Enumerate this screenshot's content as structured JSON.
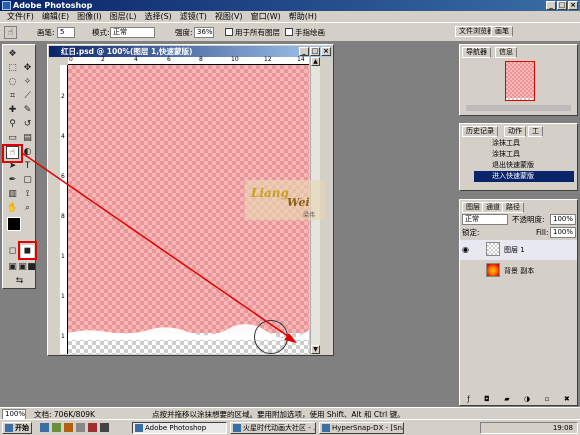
{
  "app": {
    "title": "Adobe Photoshop"
  },
  "menu": [
    "文件(F)",
    "编辑(E)",
    "图像(I)",
    "图层(L)",
    "选择(S)",
    "滤镜(T)",
    "视图(V)",
    "窗口(W)",
    "帮助(H)"
  ],
  "options": {
    "brush_label": "画笔:",
    "brush_size": "5",
    "mode_label": "模式:",
    "mode_value": "正常",
    "opacity_label": "强度:",
    "opacity_value": "36%",
    "use_all_layers": "用于所有图层",
    "finger_paint": "手指绘画",
    "tab_file_browser": "文件浏览器",
    "tab_brushes": "画笔"
  },
  "document": {
    "title": "红日.psd @ 100%(图层 1,快速蒙版)",
    "ruler_marks": [
      "0",
      "2",
      "4",
      "6",
      "8",
      "10",
      "12",
      "14"
    ],
    "vruler_marks": [
      "2",
      "4",
      "6",
      "8",
      "1",
      "1",
      "1"
    ]
  },
  "watermark": {
    "line1": "Liang",
    "line2": "Wei",
    "small": "梁伟"
  },
  "navigator": {
    "tabs": [
      "导航器",
      "信息"
    ]
  },
  "history": {
    "tabs": [
      "历史记录",
      "动作",
      "工"
    ],
    "items": [
      "涂抹工具",
      "涂抹工具",
      "退出快速蒙版",
      "进入快速蒙版"
    ]
  },
  "layers": {
    "tabs": [
      "图层",
      "通道",
      "路径"
    ],
    "blend": "正常",
    "opacity_label": "不透明度:",
    "opacity_value": "100%",
    "lock_label": "锁定:",
    "fill_label": "Fill:",
    "fill_value": "100%",
    "rows": [
      {
        "name": "图层 1"
      },
      {
        "name": "背景 副本"
      }
    ]
  },
  "status": {
    "zoom": "100%",
    "doc": "文档: 706K/809K",
    "hint": "点按并拖移以涂抹想要的区域。要用附加选项，使用 Shift、Alt 和 Ctrl 键。"
  },
  "taskbar": {
    "start": "开始",
    "tasks": [
      "Adobe Photoshop",
      "火星时代动画大社区 - ...",
      "HyperSnap-DX - [Snap5.j..."
    ],
    "clock": "19:08"
  }
}
